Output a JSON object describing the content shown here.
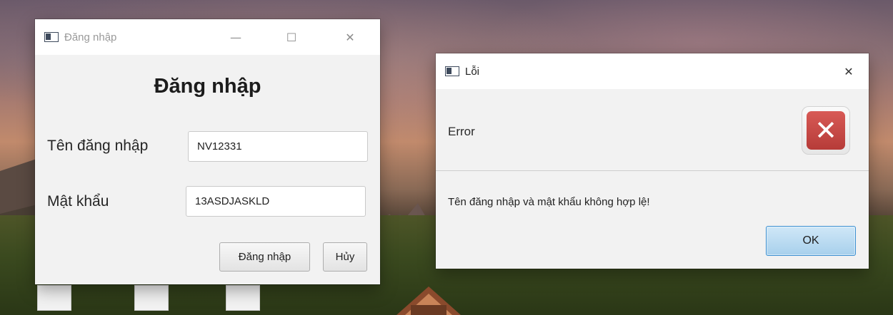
{
  "login_window": {
    "title": "Đăng nhập",
    "heading": "Đăng nhập",
    "username_label": "Tên đăng nhập",
    "username_value": "NV12331",
    "password_label": "Mật khẩu",
    "password_value": "13ASDJASKLD",
    "login_button": "Đăng nhập",
    "cancel_button": "Hủy",
    "controls": {
      "minimize": "—",
      "maximize": "☐",
      "close": "✕"
    }
  },
  "error_dialog": {
    "title": "Lỗi",
    "header_text": "Error",
    "message": "Tên đăng nhập và mật khẩu không hợp lệ!",
    "ok_button": "OK",
    "close": "✕",
    "icon": "error-x-icon",
    "icon_glyph": "✕"
  },
  "colors": {
    "error_red": "#c94945",
    "ok_button_blue": "#a8d0ec",
    "window_bg": "#f2f2f2"
  }
}
